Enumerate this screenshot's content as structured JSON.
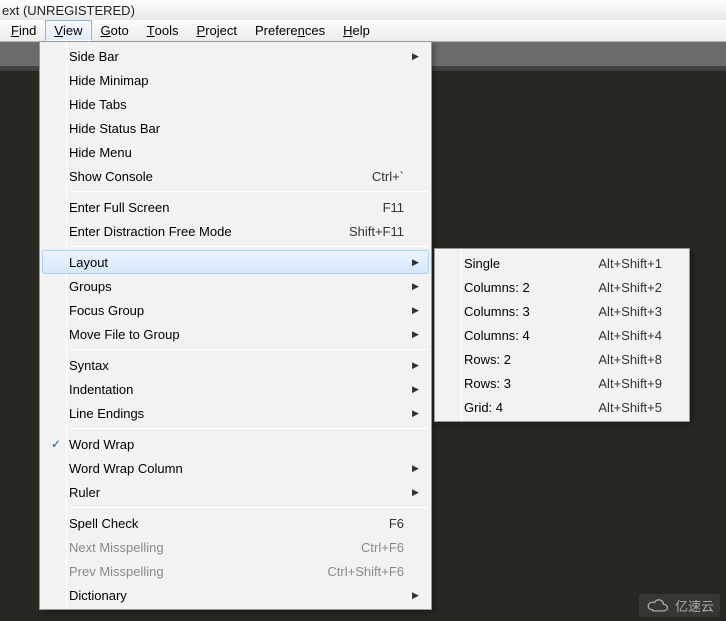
{
  "title": "ext (UNREGISTERED)",
  "menubar": [
    {
      "label": "Find",
      "ul": "F"
    },
    {
      "label": "View",
      "ul": "V",
      "open": true
    },
    {
      "label": "Goto",
      "ul": "G"
    },
    {
      "label": "Tools",
      "ul": "T"
    },
    {
      "label": "Project",
      "ul": "P"
    },
    {
      "label": "Preferences",
      "ul": "n"
    },
    {
      "label": "Help",
      "ul": "H"
    }
  ],
  "viewMenu": [
    {
      "label": "Side Bar",
      "sub": true
    },
    {
      "label": "Hide Minimap"
    },
    {
      "label": "Hide Tabs"
    },
    {
      "label": "Hide Status Bar"
    },
    {
      "label": "Hide Menu"
    },
    {
      "label": "Show Console",
      "shortcut": "Ctrl+`"
    },
    {
      "sep": true
    },
    {
      "label": "Enter Full Screen",
      "shortcut": "F11"
    },
    {
      "label": "Enter Distraction Free Mode",
      "shortcut": "Shift+F11"
    },
    {
      "sep": true
    },
    {
      "label": "Layout",
      "sub": true,
      "hover": true
    },
    {
      "label": "Groups",
      "sub": true
    },
    {
      "label": "Focus Group",
      "sub": true
    },
    {
      "label": "Move File to Group",
      "sub": true
    },
    {
      "sep": true
    },
    {
      "label": "Syntax",
      "sub": true
    },
    {
      "label": "Indentation",
      "sub": true
    },
    {
      "label": "Line Endings",
      "sub": true
    },
    {
      "sep": true
    },
    {
      "label": "Word Wrap",
      "checked": true
    },
    {
      "label": "Word Wrap Column",
      "sub": true
    },
    {
      "label": "Ruler",
      "sub": true
    },
    {
      "sep": true
    },
    {
      "label": "Spell Check",
      "shortcut": "F6"
    },
    {
      "label": "Next Misspelling",
      "shortcut": "Ctrl+F6",
      "disabled": true
    },
    {
      "label": "Prev Misspelling",
      "shortcut": "Ctrl+Shift+F6",
      "disabled": true
    },
    {
      "label": "Dictionary",
      "sub": true
    }
  ],
  "layoutMenu": [
    {
      "label": "Single",
      "shortcut": "Alt+Shift+1"
    },
    {
      "label": "Columns: 2",
      "shortcut": "Alt+Shift+2"
    },
    {
      "label": "Columns: 3",
      "shortcut": "Alt+Shift+3"
    },
    {
      "label": "Columns: 4",
      "shortcut": "Alt+Shift+4"
    },
    {
      "label": "Rows: 2",
      "shortcut": "Alt+Shift+8"
    },
    {
      "label": "Rows: 3",
      "shortcut": "Alt+Shift+9"
    },
    {
      "label": "Grid: 4",
      "shortcut": "Alt+Shift+5"
    }
  ],
  "watermark": "亿速云"
}
